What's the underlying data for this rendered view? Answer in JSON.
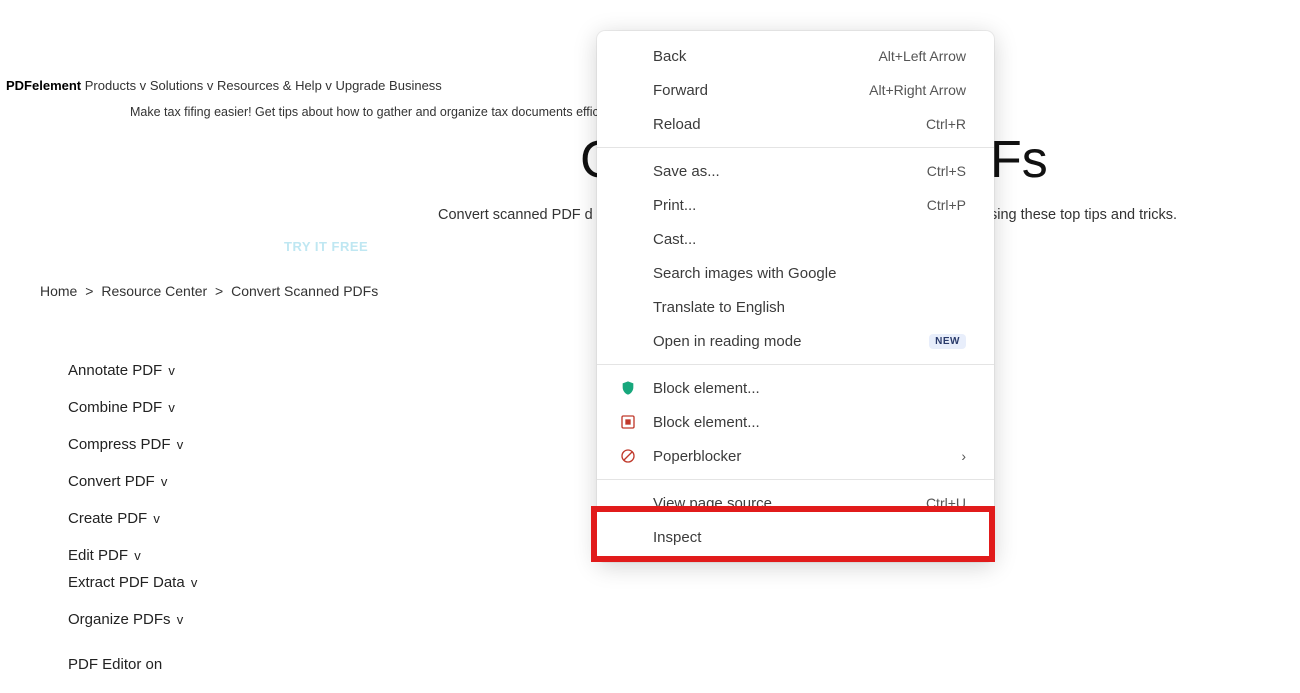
{
  "topbar": {
    "brand": "PDFelement",
    "items": [
      "Products v",
      "Solutions v",
      "Resources & Help v",
      "Upgrade",
      "Business"
    ]
  },
  "tagline": "Make tax fifing easier! Get tips about how to gather and organize tax documents efficiently. E",
  "hero": {
    "title_left": "C",
    "title_right": "Fs",
    "subtitle_left": "Convert scanned PDF d",
    "subtitle_right": "sing these top tips and tricks."
  },
  "cta": "TRY IT FREE",
  "breadcrumbs": {
    "home": "Home",
    "resource": "Resource Center",
    "current": "Convert Scanned PDFs",
    "sep": ">"
  },
  "sidebar": {
    "items": [
      "Annotate PDF",
      "Combine PDF",
      "Compress PDF",
      "Convert PDF",
      "Create PDF",
      "Edit PDF",
      "Extract PDF Data",
      "Organize PDFs",
      "PDF Editor on"
    ],
    "chev": "v"
  },
  "contextMenu": {
    "back": {
      "label": "Back",
      "shortcut": "Alt+Left Arrow"
    },
    "forward": {
      "label": "Forward",
      "shortcut": "Alt+Right Arrow"
    },
    "reload": {
      "label": "Reload",
      "shortcut": "Ctrl+R"
    },
    "saveAs": {
      "label": "Save as...",
      "shortcut": "Ctrl+S"
    },
    "print": {
      "label": "Print...",
      "shortcut": "Ctrl+P"
    },
    "cast": {
      "label": "Cast..."
    },
    "searchImages": {
      "label": "Search images with Google"
    },
    "translate": {
      "label": "Translate to English"
    },
    "readingMode": {
      "label": "Open in reading mode",
      "badge": "NEW"
    },
    "blockElement1": {
      "label": "Block element..."
    },
    "blockElement2": {
      "label": "Block element..."
    },
    "poperblocker": {
      "label": "Poperblocker"
    },
    "viewSource": {
      "label": "View page source",
      "shortcut": "Ctrl+U"
    },
    "inspect": {
      "label": "Inspect"
    }
  }
}
